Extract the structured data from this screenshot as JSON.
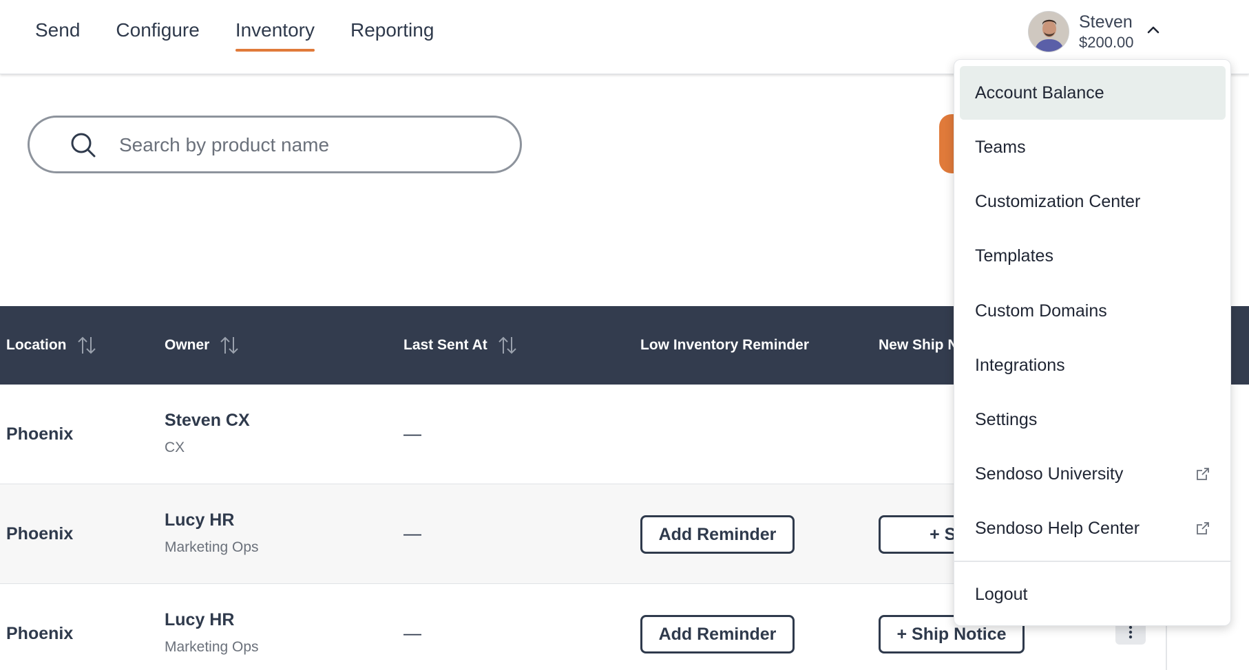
{
  "nav": {
    "items": [
      {
        "label": "Send"
      },
      {
        "label": "Configure"
      },
      {
        "label": "Inventory",
        "active": true
      },
      {
        "label": "Reporting"
      }
    ]
  },
  "user": {
    "name": "Steven",
    "balance": "$200.00"
  },
  "search": {
    "placeholder": "Search by product name"
  },
  "table": {
    "headers": {
      "location": "Location",
      "owner": "Owner",
      "last_sent": "Last Sent At",
      "low_inventory": "Low Inventory Reminder",
      "new_ship": "New Ship N"
    },
    "rows": [
      {
        "location": "Phoenix",
        "owner_name": "Steven CX",
        "owner_team": "CX",
        "last_sent": "—"
      },
      {
        "location": "Phoenix",
        "owner_name": "Lucy HR",
        "owner_team": "Marketing Ops",
        "last_sent": "—",
        "reminder_label": "Add Reminder",
        "ship_label": "+ Ship"
      },
      {
        "location": "Phoenix",
        "owner_name": "Lucy HR",
        "owner_team": "Marketing Ops",
        "last_sent": "—",
        "reminder_label": "Add Reminder",
        "ship_label": "+ Ship Notice"
      }
    ]
  },
  "menu": {
    "items": [
      {
        "label": "Account Balance",
        "active": true
      },
      {
        "label": "Teams"
      },
      {
        "label": "Customization Center"
      },
      {
        "label": "Templates"
      },
      {
        "label": "Custom Domains"
      },
      {
        "label": "Integrations"
      },
      {
        "label": "Settings"
      },
      {
        "label": "Sendoso University",
        "external": true
      },
      {
        "label": "Sendoso Help Center",
        "external": true
      }
    ],
    "logout": "Logout"
  },
  "colors": {
    "accent": "#e07a3a",
    "header_bg": "#333c4e",
    "text": "#2f3a4c",
    "menu_active": "#e8eeec"
  }
}
